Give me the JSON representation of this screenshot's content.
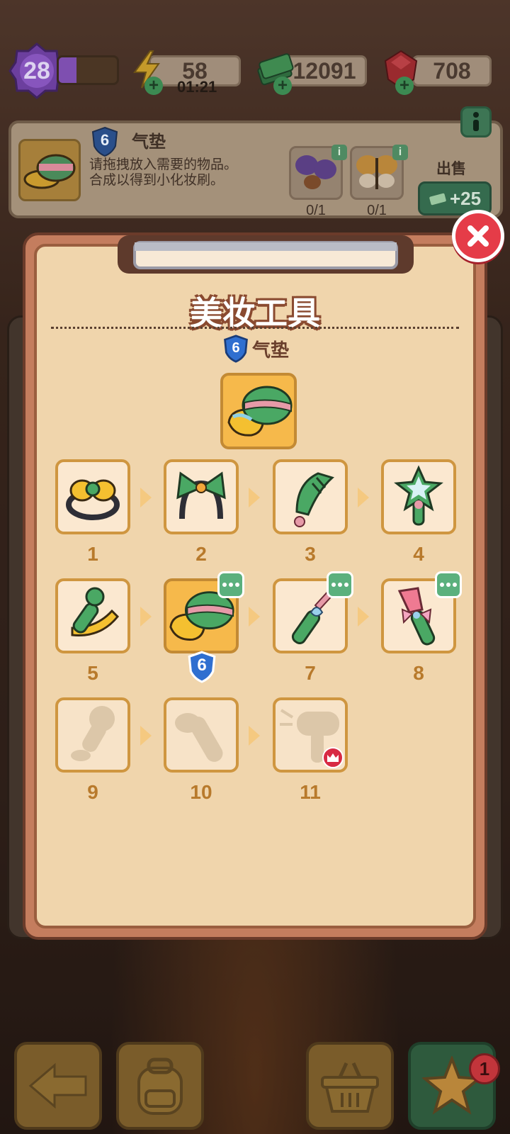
{
  "topbar": {
    "level": "28",
    "xp_fraction": 0.3,
    "energy": "58",
    "energy_timer": "01:21",
    "cash": "12091",
    "gems": "708"
  },
  "info_panel": {
    "item_level": "6",
    "item_name": "气垫",
    "description_line1": "请拖拽放入需要的物品。",
    "description_line2": "合成以得到小化妆刷。",
    "requirements": [
      {
        "count": "0/1",
        "icon": "butterfly-purple-icon"
      },
      {
        "count": "0/1",
        "icon": "butterfly-yellow-icon"
      }
    ],
    "sell_label": "出售",
    "sell_value": "+25"
  },
  "modal": {
    "title": "美妆工具",
    "featured_level": "6",
    "featured_name": "气垫",
    "items": [
      {
        "num": "1",
        "icon": "hair-clip-icon",
        "state": "unlocked"
      },
      {
        "num": "2",
        "icon": "headband-bow-icon",
        "state": "unlocked"
      },
      {
        "num": "3",
        "icon": "comb-icon",
        "state": "unlocked"
      },
      {
        "num": "4",
        "icon": "star-mirror-icon",
        "state": "unlocked"
      },
      {
        "num": "5",
        "icon": "nail-clipper-icon",
        "state": "unlocked"
      },
      {
        "num": "6",
        "icon": "cushion-compact-icon",
        "state": "current"
      },
      {
        "num": "7",
        "icon": "small-makeup-brush-icon",
        "state": "unlocked"
      },
      {
        "num": "8",
        "icon": "blush-brush-icon",
        "state": "unlocked"
      },
      {
        "num": "9",
        "icon": "locked-silhouette-icon",
        "state": "locked"
      },
      {
        "num": "10",
        "icon": "locked-silhouette-icon",
        "state": "locked"
      },
      {
        "num": "11",
        "icon": "locked-hairdryer-icon",
        "state": "locked"
      }
    ]
  },
  "bottom_bar": {
    "notification_count": "1",
    "buttons": [
      "back-arrow-icon",
      "backpack-icon",
      "basket-icon",
      "star-icon"
    ]
  },
  "colors": {
    "accent_orange": "#cf9640",
    "modal_bg": "#f0d5ac",
    "close_red": "#e53c48",
    "badge_green": "#5bb07d",
    "shield_blue": "#2f6fd0"
  }
}
